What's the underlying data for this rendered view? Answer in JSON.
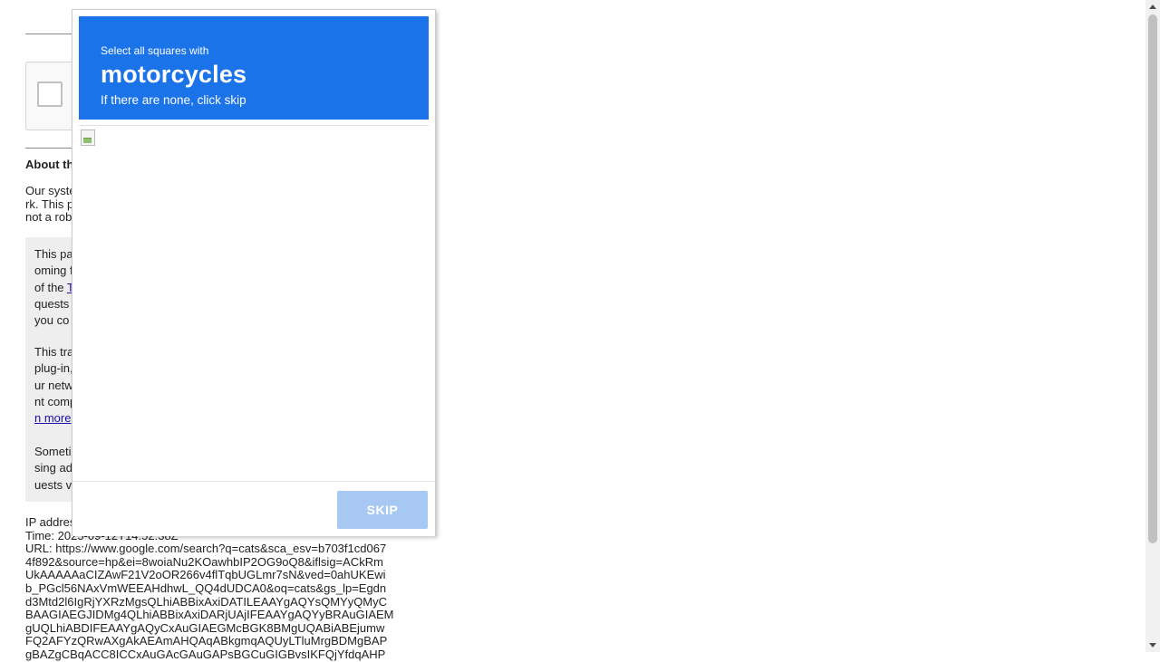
{
  "background_page": {
    "about_heading": "About th",
    "intro_lines": [
      "Our syste",
      "rk. This p",
      "not a rob"
    ],
    "grey_para1": [
      "This pa",
      "oming f",
      "of the ",
      "quests",
      "you co"
    ],
    "grey_para1_link": "T",
    "grey_para2": [
      "This tra",
      "plug-in,",
      "ur netw",
      "nt comp"
    ],
    "grey_para2_link": "n more",
    "grey_para3": [
      "Someti",
      "sing ad",
      "uests v"
    ],
    "ip_label": "IP addres",
    "time_line": "Time: 2025-09-12T14:52:38Z",
    "url_lines": [
      "URL: https://www.google.com/search?q=cats&sca_esv=b703f1cd067",
      "4f892&source=hp&ei=8woiaNu2KOawhbIP2OG9oQ8&iflsig=ACkRm",
      "UkAAAAAaCIZAwF21V2oOR266v4flTqbUGLmr7sN&ved=0ahUKEwi",
      "b_PGcl56NAxVmWEEAHdhwL_QQ4dUDCA0&oq=cats&gs_lp=Egdn",
      "d3Mtd2l6IgRjYXRzMgsQLhiABBixAxiDATILEAAYgAQYsQMYyQMyC",
      "BAAGIAEGJIDMg4QLhiABBixAxiDARjUAjIFEAAYgAQYyBRAuGIAEM",
      "gUQLhiABDIFEAAYgAQyCxAuGIAEGMcBGK8BMgUQABiABEjumw",
      "FQ2AFYzQRwAXgAkAEAmAHQAqABkgmqAQUyLTluMrgBDMgBAP",
      "gBAZgCBqACC8ICCxAuGAcGAuGAPsBGCuGIGBvsIKFQjYfdqAHP"
    ]
  },
  "captcha": {
    "instruction_small": "Select all squares with",
    "target_word": "motorcycles",
    "instruction_sub": "If there are none, click skip",
    "skip_label": "SKIP"
  },
  "colors": {
    "header_blue": "#1a73e8",
    "skip_disabled": "#a6c8f3"
  }
}
